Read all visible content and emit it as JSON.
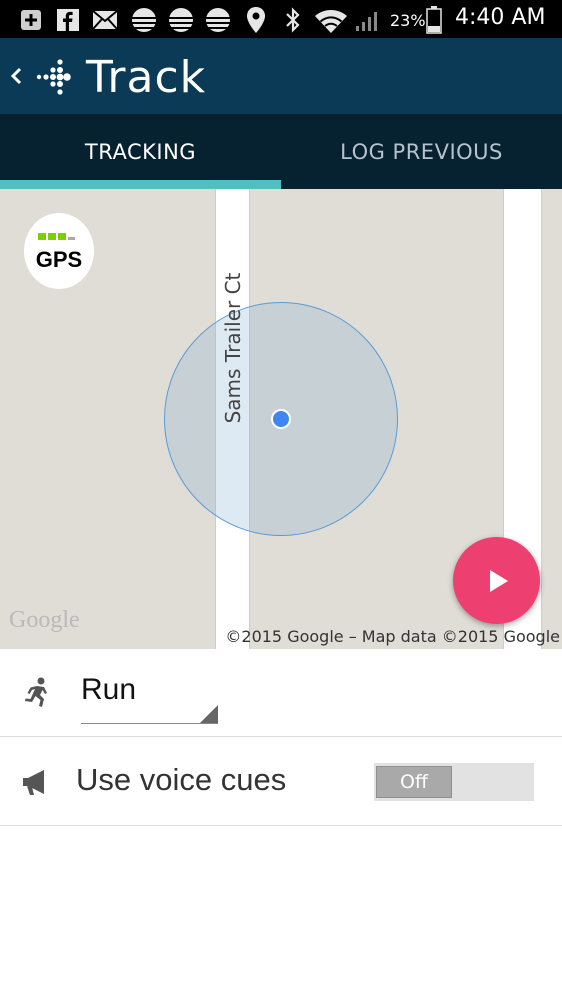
{
  "status_bar": {
    "battery": "23%",
    "time": "4:40 AM",
    "icons": [
      "add-icon",
      "facebook-icon",
      "mail-icon",
      "weather-icon",
      "weather-icon",
      "weather-icon",
      "location-icon",
      "bluetooth-icon",
      "wifi-icon",
      "signal-icon",
      "battery-icon"
    ]
  },
  "app_bar": {
    "title": "Track"
  },
  "tabs": [
    {
      "label": "TRACKING",
      "selected": true
    },
    {
      "label": "LOG PREVIOUS",
      "selected": false
    }
  ],
  "map": {
    "gps_label": "GPS",
    "street_label": "Sams Trailer Ct",
    "google_logo": "Google",
    "attribution": "©2015 Google – Map data ©2015 Google"
  },
  "activity": {
    "value": "Run"
  },
  "voice_cues": {
    "label": "Use voice cues",
    "toggle_label": "Off"
  },
  "colors": {
    "app_bar": "#0a3a55",
    "tab_bar": "#06212f",
    "tab_indicator": "#4fbfbf",
    "play_button": "#ee4070",
    "gps_green": "#7cd000",
    "location_dot": "#3f86f0"
  }
}
